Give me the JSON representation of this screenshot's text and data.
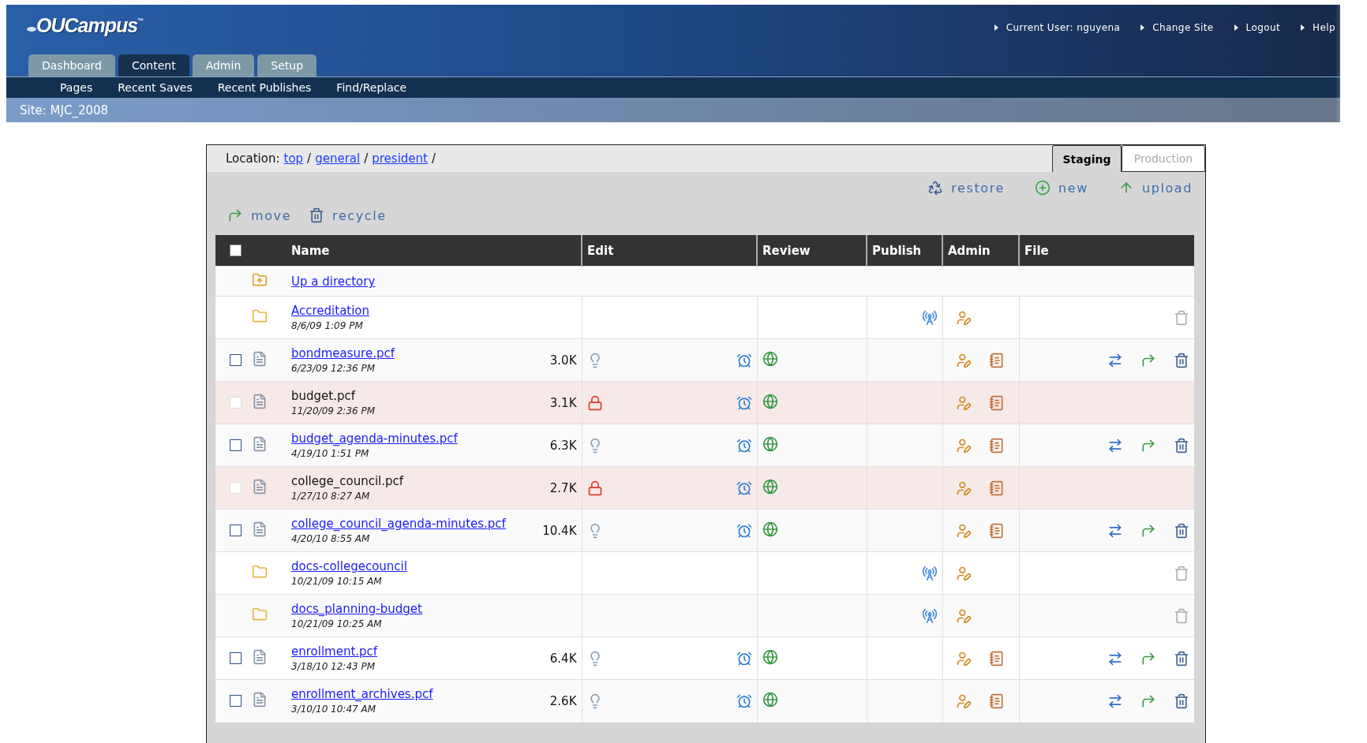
{
  "logo": {
    "text": "OUCampus",
    "mark": "™"
  },
  "user_links": [
    {
      "label": "Current User: nguyena"
    },
    {
      "label": "Change Site"
    },
    {
      "label": "Logout"
    },
    {
      "label": "Help"
    }
  ],
  "nav_tabs": [
    {
      "label": "Dashboard",
      "selected": false
    },
    {
      "label": "Content",
      "selected": true
    },
    {
      "label": "Admin",
      "selected": false
    },
    {
      "label": "Setup",
      "selected": false
    }
  ],
  "sub_nav": [
    "Pages",
    "Recent Saves",
    "Recent Publishes",
    "Find/Replace"
  ],
  "site": "Site: MJC_2008",
  "location": {
    "label": "Location:",
    "crumbs": [
      "top",
      "general",
      "president"
    ],
    "separator": "/"
  },
  "panel_tabs": [
    {
      "label": "Staging",
      "selected": true
    },
    {
      "label": "Production",
      "selected": false
    }
  ],
  "top_actions": [
    {
      "kind": "restore",
      "label": "restore"
    },
    {
      "kind": "new",
      "label": "new"
    },
    {
      "kind": "upload",
      "label": "upload"
    }
  ],
  "bottom_actions": [
    {
      "kind": "move",
      "label": "move"
    },
    {
      "kind": "recycle",
      "label": "recycle"
    }
  ],
  "table": {
    "select_all_checked": false,
    "columns": [
      "Name",
      "Edit",
      "Review",
      "Publish",
      "Admin",
      "File"
    ],
    "rows": [
      {
        "kind": "up",
        "name": "Up a directory"
      },
      {
        "kind": "folder",
        "name": "Accreditation",
        "date": "8/6/09 1:09 PM"
      },
      {
        "kind": "file",
        "name": "bondmeasure.pcf",
        "date": "6/23/09 12:36 PM",
        "size": "3.0K",
        "locked": false,
        "checked": false
      },
      {
        "kind": "file",
        "name": "budget.pcf",
        "date": "11/20/09 2:36 PM",
        "size": "3.1K",
        "locked": true,
        "checked": false
      },
      {
        "kind": "file",
        "name": "budget_agenda-minutes.pcf",
        "date": "4/19/10 1:51 PM",
        "size": "6.3K",
        "locked": false,
        "checked": false
      },
      {
        "kind": "file",
        "name": "college_council.pcf",
        "date": "1/27/10 8:27 AM",
        "size": "2.7K",
        "locked": true,
        "checked": false
      },
      {
        "kind": "file",
        "name": "college_council_agenda-minutes.pcf",
        "date": "4/20/10 8:55 AM",
        "size": "10.4K",
        "locked": false,
        "checked": false
      },
      {
        "kind": "folder",
        "name": "docs-collegecouncil",
        "date": "10/21/09 10:15 AM"
      },
      {
        "kind": "folder",
        "name": "docs_planning-budget",
        "date": "10/21/09 10:25 AM"
      },
      {
        "kind": "file",
        "name": "enrollment.pcf",
        "date": "3/18/10 12:43 PM",
        "size": "6.4K",
        "locked": false,
        "checked": false
      },
      {
        "kind": "file",
        "name": "enrollment_archives.pcf",
        "date": "3/10/10 10:47 AM",
        "size": "2.6K",
        "locked": false,
        "checked": false
      }
    ]
  }
}
